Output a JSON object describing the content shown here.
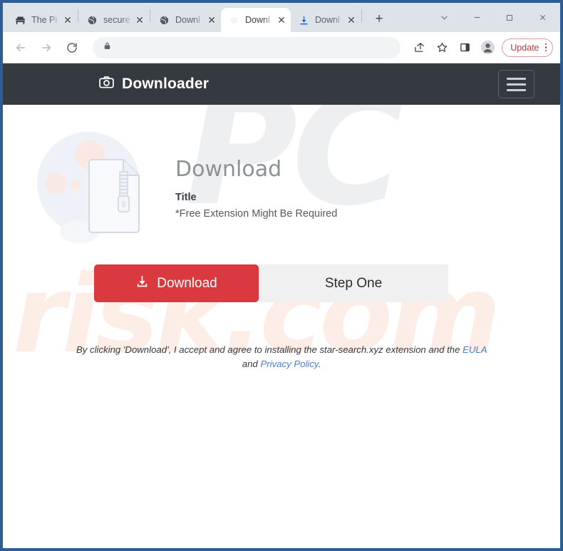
{
  "browser": {
    "tabs": [
      {
        "title": "The Pi",
        "favicon": "bench-icon",
        "active": false,
        "close_label": "✕"
      },
      {
        "title": "secure",
        "favicon": "globe-icon",
        "active": false,
        "close_label": "✕"
      },
      {
        "title": "Downl",
        "favicon": "globe-icon",
        "active": false,
        "close_label": "✕"
      },
      {
        "title": "Downl",
        "favicon": "page-icon",
        "active": true,
        "close_label": "✕"
      },
      {
        "title": "Downl",
        "favicon": "download-icon",
        "active": false,
        "close_label": "✕"
      }
    ],
    "new_tab_label": "+",
    "window_controls": {
      "tab_search": "tab-search-chevron",
      "minimize": "—",
      "maximize": "□",
      "close": "✕"
    },
    "toolbar": {
      "back": "back-arrow",
      "forward": "forward-arrow",
      "reload": "reload-arrow",
      "lock": "lock-icon",
      "address_value": "",
      "address_placeholder": "",
      "share": "share-icon",
      "bookmark": "star-icon",
      "side_panel": "side-panel-icon",
      "profile": "profile-avatar-icon",
      "update_label": "Update",
      "menu": "three-dot-menu"
    }
  },
  "page": {
    "watermark": {
      "top": "PC",
      "bottom": "risk.com"
    },
    "header": {
      "brand_icon": "camera-icon",
      "brand_text": "Downloader",
      "menu_toggle": "hamburger-menu-icon"
    },
    "hero": {
      "artwork": "zip-file-magnifier-illustration",
      "heading": "Download",
      "title": "Title",
      "note": "*Free Extension Might Be Required"
    },
    "actions": {
      "download_label": "Download",
      "download_icon": "download-tray-icon",
      "step_label": "Step One"
    },
    "disclaimer": {
      "part1": "By clicking 'Download', I accept and agree to installing the star-search.xyz extension and the",
      "link_eula": "EULA",
      "conjunction": "and",
      "link_privacy": "Privacy Policy",
      "period": "."
    }
  },
  "colors": {
    "window_border": "#2e5d96",
    "tabstrip": "#dee3ea",
    "site_header": "#343a40",
    "download_red": "#d9393f",
    "step_gray": "#f0f0f0",
    "link_blue": "#4a7fd1",
    "update_red": "#b33b3b",
    "watermark_gray": "#eeeff1",
    "watermark_peach": "#fceee6"
  }
}
